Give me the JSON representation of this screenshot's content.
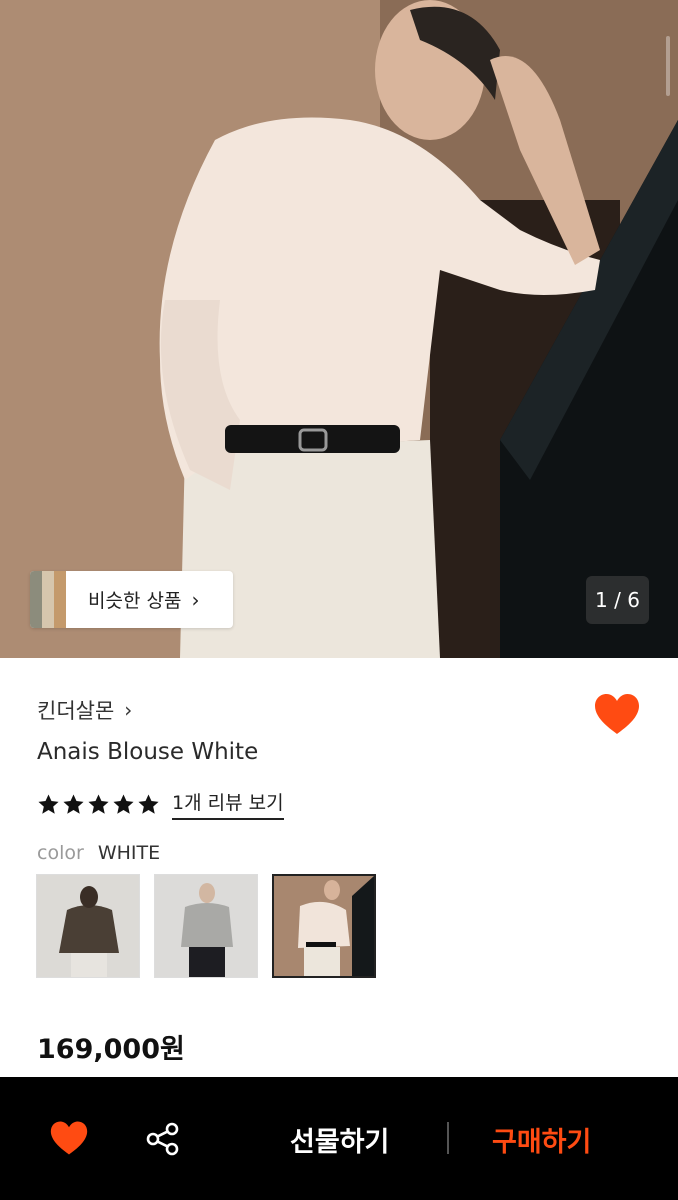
{
  "hero": {
    "counter": "1 / 6",
    "similar_label": "비슷한 상품",
    "similar_chevron": "›"
  },
  "product": {
    "brand": "킨더살몬",
    "brand_chevron": "›",
    "title": "Anais Blouse White",
    "rating_stars": 5,
    "review_link": "1개 리뷰 보기",
    "color_label": "color",
    "color_value": "WHITE",
    "price": "169,000원",
    "swatches": [
      {
        "name": "dark-brown",
        "selected": false
      },
      {
        "name": "grey",
        "selected": false
      },
      {
        "name": "white",
        "selected": true
      }
    ]
  },
  "bottom_bar": {
    "gift_label": "선물하기",
    "buy_label": "구매하기"
  },
  "colors": {
    "accent": "#ff4b12",
    "bottom_bar_bg": "#000000"
  },
  "icons": [
    "heart-icon",
    "share-icon",
    "star-icon",
    "chevron-right-icon"
  ]
}
